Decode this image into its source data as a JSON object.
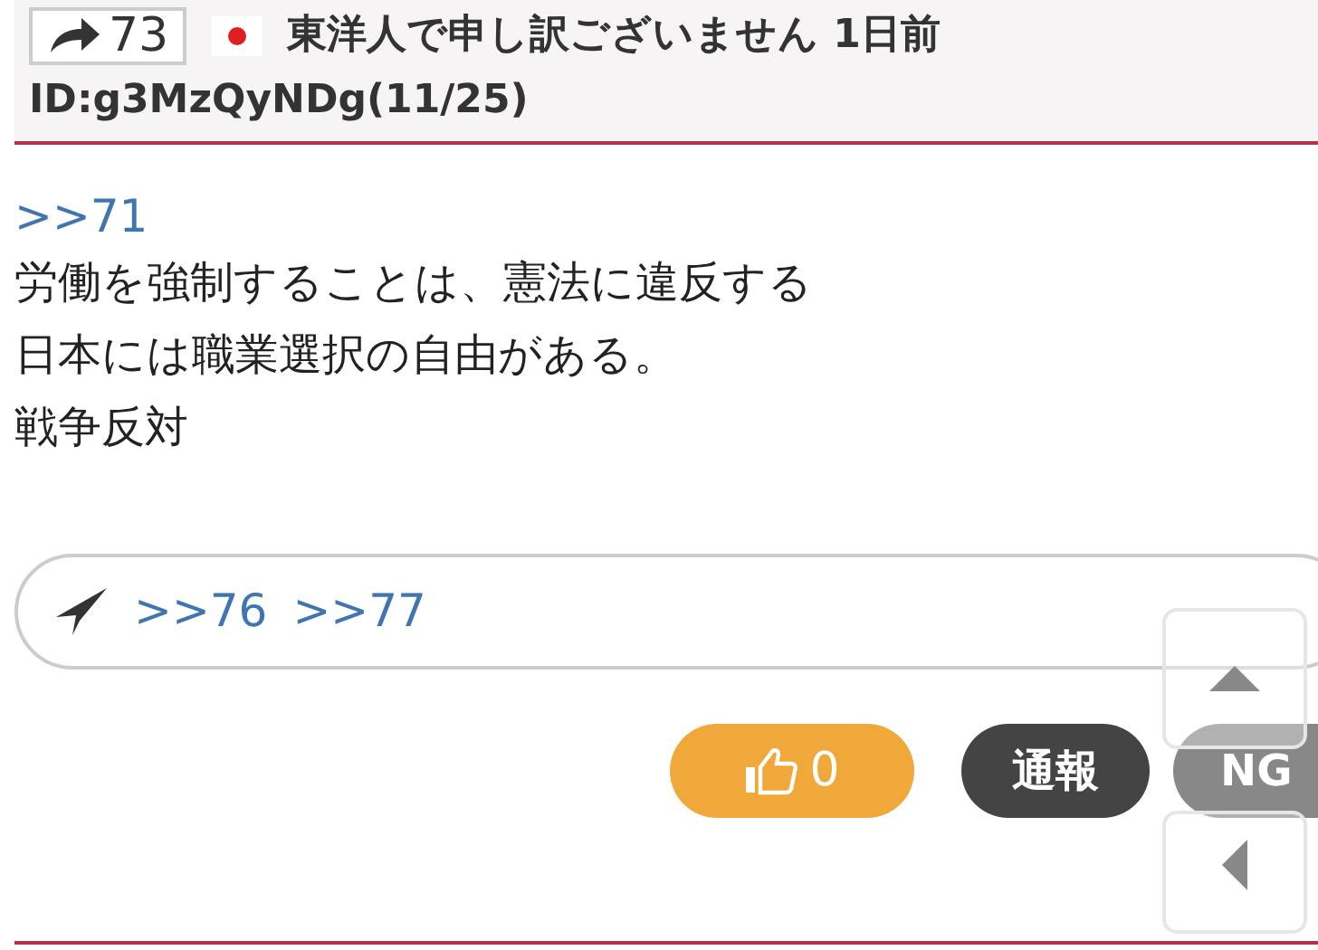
{
  "header": {
    "share_count": "73",
    "poster": "東洋人で申し訳ございません",
    "date": "1日前",
    "id": "ID:g3MzQyNDg(11/25)"
  },
  "post": {
    "reply_to": ">>71",
    "lines": [
      "労働を強制することは、憲法に違反する",
      "日本には職業選択の自由がある。",
      "戦争反対"
    ]
  },
  "replies": [
    ">>76",
    ">>77"
  ],
  "actions": [
    {
      "kind": "like",
      "label": "0"
    },
    {
      "kind": "report",
      "label": "通報"
    },
    {
      "kind": "ng",
      "label": "NG"
    }
  ]
}
